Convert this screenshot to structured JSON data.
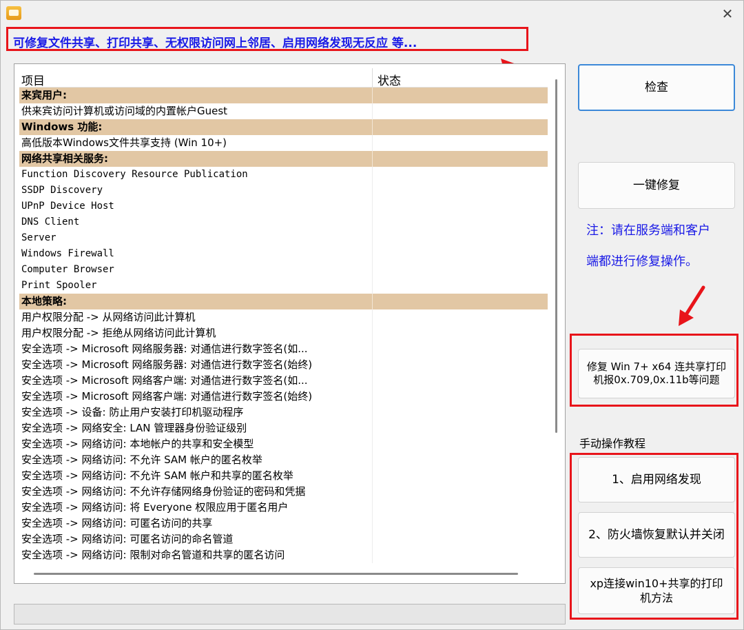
{
  "window": {
    "close_glyph": "✕",
    "icon": "app-icon"
  },
  "banner": "可修复文件共享、打印共享、无权限访问网上邻居、启用网络发现无反应  等...",
  "list": {
    "columns": [
      "项目",
      "状态"
    ],
    "rows": [
      {
        "text": "来宾用户:",
        "type": "category"
      },
      {
        "text": "供来宾访问计算机或访问域的内置帐户Guest",
        "type": "item"
      },
      {
        "text": "Windows 功能:",
        "type": "category"
      },
      {
        "text": "高低版本Windows文件共享支持 (Win 10+)",
        "type": "item"
      },
      {
        "text": "网络共享相关服务:",
        "type": "category"
      },
      {
        "text": "Function Discovery Resource Publication",
        "type": "mono"
      },
      {
        "text": "SSDP Discovery",
        "type": "mono"
      },
      {
        "text": "UPnP Device Host",
        "type": "mono"
      },
      {
        "text": "DNS Client",
        "type": "mono"
      },
      {
        "text": "Server",
        "type": "mono"
      },
      {
        "text": "Windows Firewall",
        "type": "mono"
      },
      {
        "text": "Computer Browser",
        "type": "mono"
      },
      {
        "text": "Print Spooler",
        "type": "mono"
      },
      {
        "text": "本地策略:",
        "type": "category"
      },
      {
        "text": "用户权限分配 -> 从网络访问此计算机",
        "type": "item"
      },
      {
        "text": "用户权限分配 -> 拒绝从网络访问此计算机",
        "type": "item"
      },
      {
        "text": "安全选项 -> Microsoft 网络服务器: 对通信进行数字签名(如...",
        "type": "item"
      },
      {
        "text": "安全选项 -> Microsoft 网络服务器: 对通信进行数字签名(始终)",
        "type": "item"
      },
      {
        "text": "安全选项 -> Microsoft 网络客户端: 对通信进行数字签名(如...",
        "type": "item"
      },
      {
        "text": "安全选项 -> Microsoft 网络客户端: 对通信进行数字签名(始终)",
        "type": "item"
      },
      {
        "text": "安全选项 -> 设备: 防止用户安装打印机驱动程序",
        "type": "item"
      },
      {
        "text": "安全选项 -> 网络安全: LAN 管理器身份验证级别",
        "type": "item"
      },
      {
        "text": "安全选项 -> 网络访问: 本地帐户的共享和安全模型",
        "type": "item"
      },
      {
        "text": "安全选项 -> 网络访问: 不允许 SAM 帐户的匿名枚举",
        "type": "item"
      },
      {
        "text": "安全选项 -> 网络访问: 不允许 SAM 帐户和共享的匿名枚举",
        "type": "item"
      },
      {
        "text": "安全选项 -> 网络访问: 不允许存储网络身份验证的密码和凭据",
        "type": "item"
      },
      {
        "text": "安全选项 -> 网络访问: 将 Everyone 权限应用于匿名用户",
        "type": "item"
      },
      {
        "text": "安全选项 -> 网络访问: 可匿名访问的共享",
        "type": "item"
      },
      {
        "text": "安全选项 -> 网络访问: 可匿名访问的命名管道",
        "type": "item"
      },
      {
        "text": "安全选项 -> 网络访问: 限制对命名管道和共享的匿名访问",
        "type": "item"
      }
    ]
  },
  "buttons": {
    "check": "检查",
    "fix_all": "一键修复",
    "fix_printer": "修复 Win 7+ x64 连共享打印机报0x.709,0x.11b等问题",
    "enable_discovery": "1、启用网络发现",
    "firewall": "2、防火墙恢复默认并关闭",
    "xp_connect": "xp连接win10+共享的打印机方法"
  },
  "note": {
    "line1": "注：请在服务端和客户",
    "line2": "端都进行修复操作。"
  },
  "manual_group_label": "手动操作教程",
  "colors": {
    "category_bg": "#e2c7a4",
    "highlight_red": "#e8141a",
    "banner_blue": "#1a1ae6",
    "primary_border": "#3b88d8"
  }
}
